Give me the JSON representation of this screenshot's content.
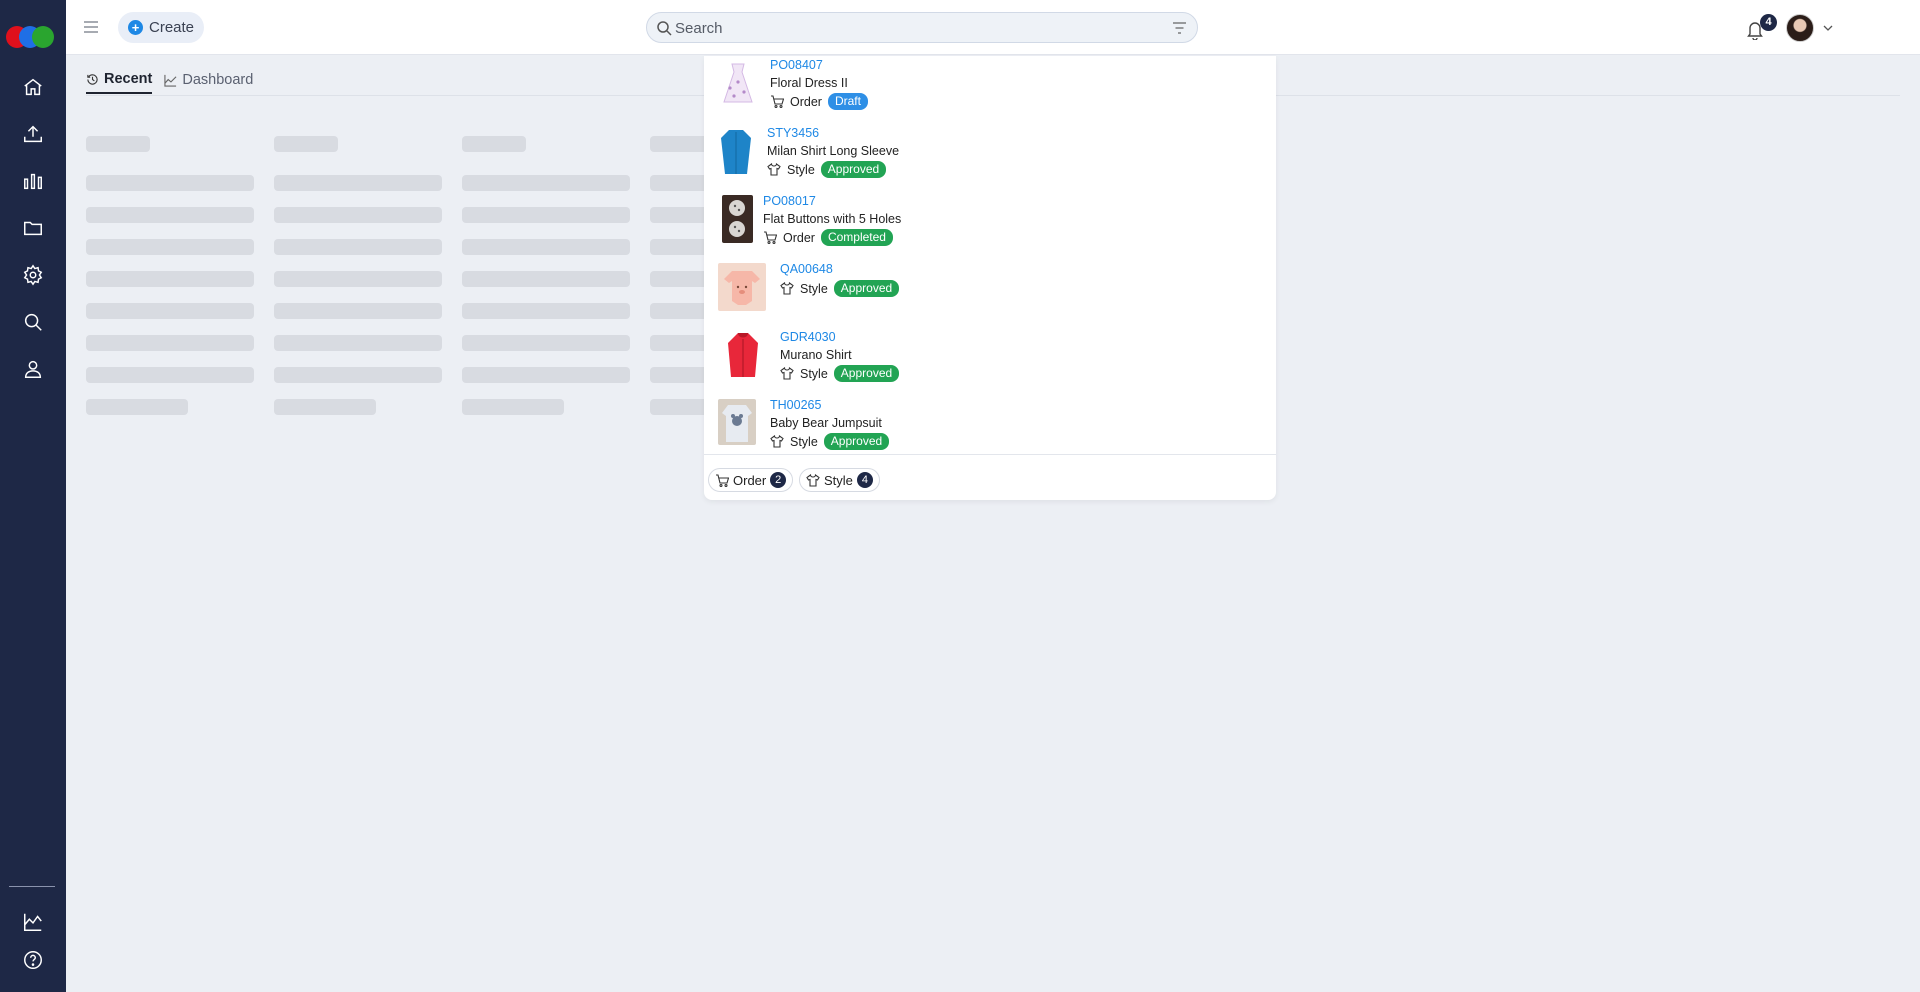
{
  "app": {
    "create_label": "Create",
    "notification_count": "4"
  },
  "search": {
    "placeholder": "Search",
    "value": ""
  },
  "tabs": [
    {
      "label": "Recent",
      "active": true
    },
    {
      "label": "Dashboard",
      "active": false
    }
  ],
  "results": [
    {
      "code": "PO08407",
      "name": "Floral Dress II",
      "type": "Order",
      "type_icon": "cart-icon",
      "status": "Draft",
      "status_color": "#2e8fe6"
    },
    {
      "code": "STY3456",
      "name": "Milan Shirt Long Sleeve",
      "type": "Style",
      "type_icon": "tshirt-icon",
      "status": "Approved",
      "status_color": "#22a454"
    },
    {
      "code": "PO08017",
      "name": "Flat Buttons with 5 Holes",
      "type": "Order",
      "type_icon": "cart-icon",
      "status": "Completed",
      "status_color": "#22a454"
    },
    {
      "code": "QA00648",
      "name": "",
      "type": "Style",
      "type_icon": "tshirt-icon",
      "status": "Approved",
      "status_color": "#22a454"
    },
    {
      "code": "GDR4030",
      "name": "Murano Shirt",
      "type": "Style",
      "type_icon": "tshirt-icon",
      "status": "Approved",
      "status_color": "#22a454"
    },
    {
      "code": "TH00265",
      "name": "Baby Bear Jumpsuit",
      "type": "Style",
      "type_icon": "tshirt-icon",
      "status": "Approved",
      "status_color": "#22a454"
    }
  ],
  "filters": [
    {
      "label": "Order",
      "count": "2",
      "icon": "cart-icon"
    },
    {
      "label": "Style",
      "count": "4",
      "icon": "tshirt-icon"
    }
  ],
  "sidebar": {
    "items": [
      "home-icon",
      "upload-icon",
      "bar-chart-icon",
      "folder-icon",
      "gear-icon",
      "search-icon",
      "user-icon",
      "line-chart-icon",
      "help-icon"
    ]
  }
}
